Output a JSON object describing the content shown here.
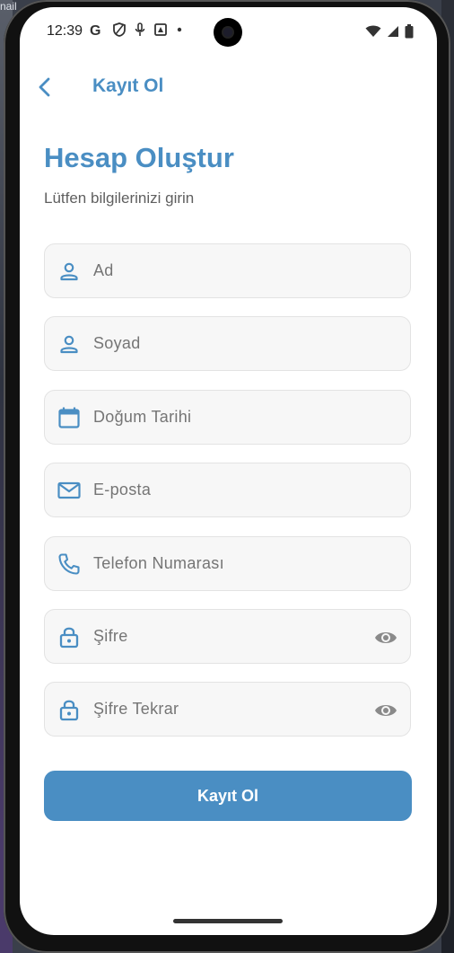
{
  "background": {
    "corner_text": "nail"
  },
  "status_bar": {
    "time": "12:39",
    "icons": [
      "google-icon",
      "shield-icon",
      "mic-icon",
      "app-icon",
      "dot-icon"
    ],
    "right_icons": [
      "wifi-icon",
      "signal-icon",
      "battery-icon"
    ]
  },
  "app_bar": {
    "title": "Kayıt Ol"
  },
  "main": {
    "heading": "Hesap Oluştur",
    "subheading": "Lütfen bilgilerinizi girin"
  },
  "form": {
    "fields": [
      {
        "placeholder": "Ad",
        "icon": "person-icon"
      },
      {
        "placeholder": "Soyad",
        "icon": "person-icon"
      },
      {
        "placeholder": "Doğum Tarihi",
        "icon": "calendar-icon"
      },
      {
        "placeholder": "E-posta",
        "icon": "mail-icon"
      },
      {
        "placeholder": "Telefon Numarası",
        "icon": "phone-icon"
      },
      {
        "placeholder": "Şifre",
        "icon": "lock-icon",
        "trailing_icon": "eye-icon"
      },
      {
        "placeholder": "Şifre Tekrar",
        "icon": "lock-icon",
        "trailing_icon": "eye-icon"
      }
    ],
    "submit_label": "Kayıt Ol"
  },
  "colors": {
    "accent": "#4a8ec3",
    "field_bg": "#f7f7f7",
    "field_border": "#e3e3e3",
    "placeholder": "#9a9a9a"
  }
}
